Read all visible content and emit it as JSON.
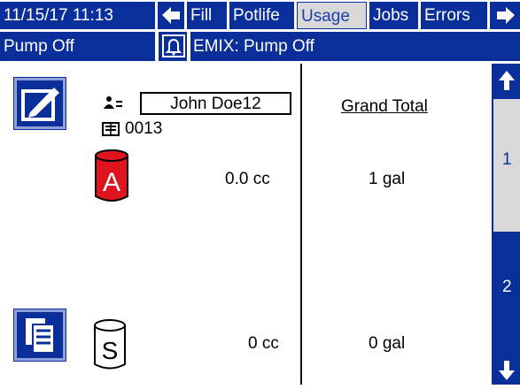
{
  "header": {
    "datetime": "11/15/17 11:13",
    "tabs": [
      {
        "label": "Fill"
      },
      {
        "label": "Potlife"
      },
      {
        "label": "Usage"
      },
      {
        "label": "Jobs"
      },
      {
        "label": "Errors"
      }
    ],
    "selected_tab": "Usage"
  },
  "status": {
    "pump": "Pump Off",
    "alarm": "EMIX: Pump Off"
  },
  "user": {
    "name": "John Doe12",
    "job_number": "0013"
  },
  "materials": [
    {
      "letter": "A",
      "amount": "0.0 cc",
      "grand_total": "1 gal",
      "color": "#e0141c"
    },
    {
      "letter": "S",
      "amount": "0 cc",
      "grand_total": "0 gal",
      "color": "#ffffff"
    }
  ],
  "grand_total_title": "Grand Total",
  "pages": [
    "1",
    "2"
  ],
  "colors": {
    "primary": "#0b2f9a",
    "selected": "#d8d8d8",
    "material_a": "#e0141c"
  }
}
